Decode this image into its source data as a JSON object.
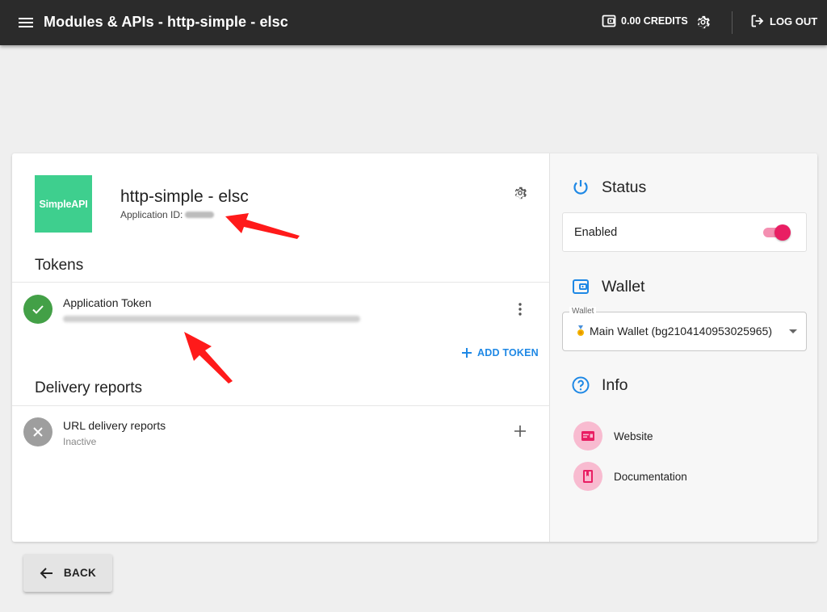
{
  "topbar": {
    "title": "Modules & APIs - http-simple - elsc",
    "credits": "0.00 CREDITS",
    "logout": "LOG OUT"
  },
  "app": {
    "logo_text": "SimpleAPI",
    "name": "http-simple - elsc",
    "id_label": "Application ID:"
  },
  "tokens": {
    "section_title": "Tokens",
    "item_title": "Application Token",
    "add_label": "ADD TOKEN"
  },
  "delivery": {
    "section_title": "Delivery reports",
    "item_title": "URL delivery reports",
    "item_status": "Inactive"
  },
  "status": {
    "title": "Status",
    "label": "Enabled",
    "enabled": true
  },
  "wallet": {
    "title": "Wallet",
    "field_label": "Wallet",
    "selected": "Main Wallet (bg2104140953025965)"
  },
  "info": {
    "title": "Info",
    "links": [
      {
        "label": "Website",
        "icon": "web-icon"
      },
      {
        "label": "Documentation",
        "icon": "book-icon"
      }
    ]
  },
  "back": {
    "label": "BACK"
  },
  "colors": {
    "topbar": "#2b2b2b",
    "logo": "#3ecf8e",
    "success": "#43a047",
    "inactive": "#9e9e9e",
    "accent_blue": "#1e88e5",
    "toggle": "#e91e63",
    "info_circle": "#f8bbd0",
    "annotation_arrow": "#ff0000"
  }
}
